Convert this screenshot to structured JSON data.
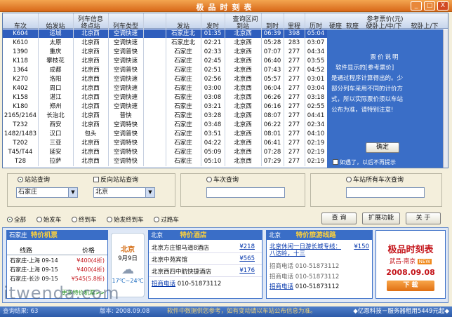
{
  "app": {
    "title": "极品时刻表",
    "min": "_",
    "max": "□",
    "close": "X"
  },
  "table": {
    "group_headers": [
      "列车信息",
      "查询区间",
      "参考票价(元)"
    ],
    "columns": [
      "车次",
      "始发站",
      "终点站",
      "列车类型",
      "发站",
      "发时",
      "到站",
      "到时",
      "里程",
      "历时",
      "硬座",
      "软座",
      "硬卧上/中/下",
      "软卧上/下"
    ],
    "rows": [
      [
        "K604",
        "运城",
        "北京西",
        "空调快速",
        "石家庄北",
        "01:35",
        "北京西",
        "06:39",
        "398",
        "05:04"
      ],
      [
        "K610",
        "太原",
        "北京西",
        "空调快速",
        "石家庄北",
        "02:21",
        "北京西",
        "05:28",
        "283",
        "03:07"
      ],
      [
        "1390",
        "重庆",
        "北京西",
        "空调普快",
        "石家庄",
        "02:33",
        "北京西",
        "07:07",
        "277",
        "04:34"
      ],
      [
        "K118",
        "攀枝花",
        "北京西",
        "空调快速",
        "石家庄",
        "02:45",
        "北京西",
        "06:40",
        "277",
        "03:55"
      ],
      [
        "1364",
        "成都",
        "北京西",
        "空调普快",
        "石家庄",
        "02:51",
        "北京西",
        "07:43",
        "277",
        "04:52"
      ],
      [
        "K270",
        "洛阳",
        "北京西",
        "空调快速",
        "石家庄",
        "02:56",
        "北京西",
        "05:57",
        "277",
        "03:01"
      ],
      [
        "K402",
        "周口",
        "北京西",
        "空调快速",
        "石家庄",
        "03:00",
        "北京西",
        "06:04",
        "277",
        "03:04"
      ],
      [
        "K158",
        "湛江",
        "北京西",
        "空调快速",
        "石家庄",
        "03:08",
        "北京西",
        "06:26",
        "277",
        "03:18"
      ],
      [
        "K180",
        "郑州",
        "北京西",
        "空调快速",
        "石家庄",
        "03:21",
        "北京西",
        "06:16",
        "277",
        "02:55"
      ],
      [
        "2165/2164",
        "长治北",
        "北京西",
        "普快",
        "石家庄",
        "03:28",
        "北京西",
        "08:07",
        "277",
        "04:41"
      ],
      [
        "T232",
        "西安",
        "北京西",
        "空调特快",
        "石家庄",
        "03:48",
        "北京西",
        "06:22",
        "277",
        "02:34"
      ],
      [
        "1482/1483",
        "汉口",
        "包头",
        "空调普快",
        "石家庄",
        "03:51",
        "北京西",
        "08:01",
        "277",
        "04:10"
      ],
      [
        "T202",
        "三亚",
        "北京西",
        "空调特快",
        "石家庄",
        "04:22",
        "北京西",
        "06:41",
        "277",
        "02:19"
      ],
      [
        "T45/T44",
        "延安",
        "北京西",
        "空调特快",
        "石家庄",
        "05:09",
        "北京西",
        "07:28",
        "277",
        "02:19"
      ],
      [
        "T28",
        "拉萨",
        "北京西",
        "空调特快",
        "石家庄",
        "05:10",
        "北京西",
        "07:29",
        "277",
        "02:19"
      ]
    ]
  },
  "fare_panel": {
    "title": "票价说明",
    "text": [
      "软件显示的[参考票价]",
      "是通过程序计算得出的。少",
      "部分列车采用不同的计价方",
      "式，所以实际票价须以车站",
      "公布为准，请特别注意!"
    ],
    "ok": "确定",
    "checkbox": "如遇了，以后不再提示"
  },
  "query": {
    "station_label": "站站查询",
    "reverse_label": "反向站站查询",
    "from": "石家庄",
    "to": "北京",
    "train_label": "车次查询",
    "train_value": "",
    "allstation_label": "车站所有车次查询",
    "allstation_value": "",
    "filters": [
      "全部",
      "始发车",
      "终到车",
      "始发终到车",
      "过路车"
    ],
    "query_btn": "查 询",
    "ext_btn": "扩展功能",
    "about_btn": "关 于"
  },
  "ads": {
    "flights": {
      "city": "石家庄",
      "title": "特价机票",
      "h1": "线路",
      "h2": "价格",
      "items": [
        [
          "石家庄-上海 09-14",
          "¥400(4折)"
        ],
        [
          "石家庄-上海 09-15",
          "¥400(4折)"
        ],
        [
          "石家庄-长沙 09-15",
          "¥545(5.8折)"
        ]
      ],
      "more": "更多特价机票>>"
    },
    "weather": {
      "city": "北京",
      "date": "9月9日",
      "temp": "17℃~24℃"
    },
    "hotels": {
      "city": "北京",
      "title": "特价酒店",
      "items": [
        [
          "北京方庄银马道8酒店",
          "¥218"
        ],
        [
          "北京中苑宾馆",
          "¥565"
        ],
        [
          "北京西四中航快捷酒店",
          "¥176"
        ]
      ],
      "phone_label": "招商电话",
      "phone": "010-51873112"
    },
    "tours": {
      "city": "北京",
      "title": "特价旅游线路",
      "items": [
        [
          "北京休闲一日游长城专线：八达岭，十三",
          "¥150"
        ],
        [
          "招商电话 010-51873112",
          ""
        ],
        [
          "招商电话 010-51873112",
          ""
        ]
      ],
      "phone_label": "招商电话",
      "phone": "010-51873112"
    },
    "promo": {
      "title": "极品时刻表",
      "route": "武昌-南京",
      "new": "NEW",
      "date": "2008.09.08",
      "download": "下 载"
    }
  },
  "status": {
    "left": "查询结果: 63",
    "version": "版本: 2008.09.08",
    "notice": "软件中数据供您参考，如有变动请以车站公布信息为准。",
    "right": "◆亿恩科技－服务器租用5449元起◆"
  },
  "watermark": "itwenda.com"
}
